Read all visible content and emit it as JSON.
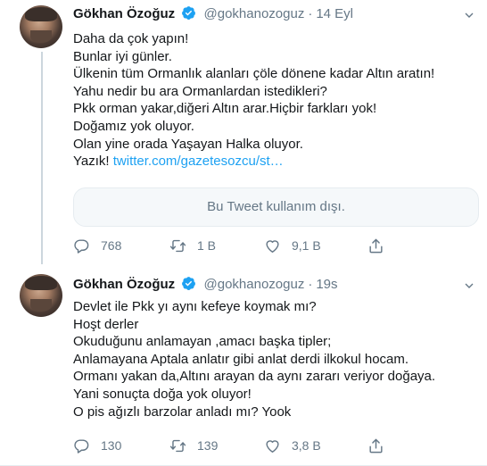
{
  "tweets": [
    {
      "name": "Gökhan Özoğuz",
      "handle": "@gokhanozoguz",
      "separator": "·",
      "time": "14 Eyl",
      "lines": [
        "Daha da çok yapın!",
        "Bunlar iyi günler.",
        "Ülkenin tüm Ormanlık alanları çöle dönene kadar Altın aratın!",
        "Yahu nedir bu ara Ormanlardan istedikleri?",
        "Pkk orman yakar,diğeri Altın arar.Hiçbir farkları yok!",
        "Doğamız yok oluyor.",
        "Olan yine orada Yaşayan Halka oluyor."
      ],
      "last_line_prefix": "Yazık! ",
      "link_text": "twitter.com/gazetesozcu/st…",
      "quote_unavailable": "Bu Tweet kullanım dışı.",
      "reply_count": "768",
      "retweet_count": "1 B",
      "like_count": "9,1 B"
    },
    {
      "name": "Gökhan Özoğuz",
      "handle": "@gokhanozoguz",
      "separator": "·",
      "time": "19s",
      "lines": [
        "Devlet ile Pkk yı aynı kefeye koymak mı?",
        "Hoşt derler",
        "Okuduğunu anlamayan ,amacı başka tipler;",
        "Anlamayana Aptala anlatır gibi anlat derdi ilkokul hocam.",
        "Ormanı yakan da,Altını arayan da aynı zararı veriyor doğaya.",
        "Yani sonuçta doğa yok oluyor!",
        "O pis ağızlı barzolar anladı mı? Yook"
      ],
      "reply_count": "130",
      "retweet_count": "139",
      "like_count": "3,8 B"
    }
  ],
  "colors": {
    "accent": "#1da1f2",
    "muted": "#657786",
    "text": "#14171a",
    "border": "#e6ecf0"
  },
  "icons": {
    "reply": "reply-icon",
    "retweet": "retweet-icon",
    "like": "heart-icon",
    "share": "share-icon",
    "verified": "verified-badge-icon",
    "more": "chevron-down-icon"
  }
}
